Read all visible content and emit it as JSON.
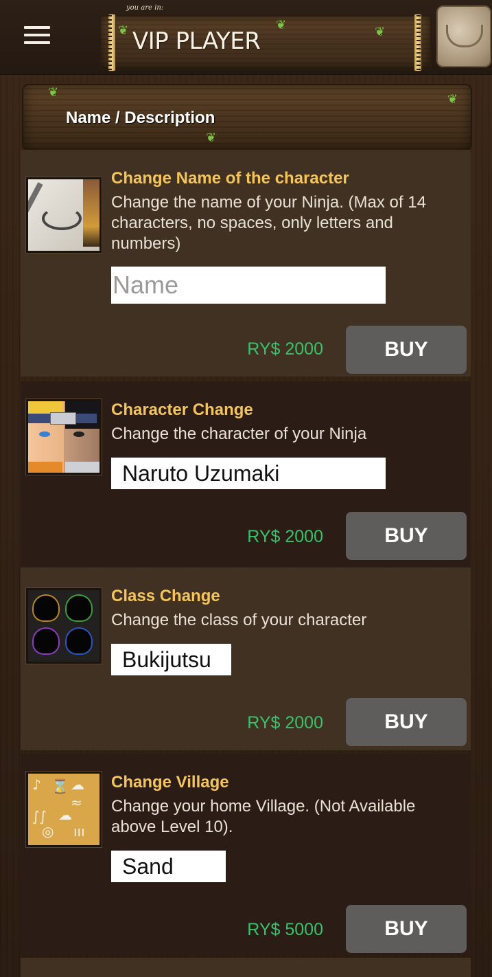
{
  "header": {
    "you_are_in": "you are in:",
    "title": "VIP PLAYER",
    "menu_icon": "hamburger-menu-icon",
    "bag_icon": "inventory-bag-icon"
  },
  "list_header": {
    "label": "Name / Description"
  },
  "items": [
    {
      "title": "Change Name of the character",
      "description": "Change the name of your Ninja. (Max of 14 characters, no spaces, only letters and numbers)",
      "input_placeholder": "Name",
      "input_value": "",
      "price": "RY$ 2000",
      "buy_label": "BUY",
      "icon": "brush-icon"
    },
    {
      "title": "Character Change",
      "description": "Change the character of your Ninja",
      "selected": "Naruto Uzumaki",
      "price": "RY$ 2000",
      "buy_label": "BUY",
      "icon": "character-portrait-icon"
    },
    {
      "title": "Class Change",
      "description": "Change the class of your character",
      "selected": "Bukijutsu",
      "price": "RY$ 2000",
      "buy_label": "BUY",
      "icon": "class-silhouettes-icon"
    },
    {
      "title": "Change Village",
      "description": "Change your home Village. (Not Available above Level 10).",
      "selected": "Sand",
      "price": "RY$ 5000",
      "buy_label": "BUY",
      "icon": "village-symbols-icon"
    }
  ],
  "colors": {
    "title": "#f4c55e",
    "price": "#37c26b",
    "buy_button": "#5e5d5b",
    "row_light": "#413122",
    "row_dark": "#2b1d15"
  }
}
